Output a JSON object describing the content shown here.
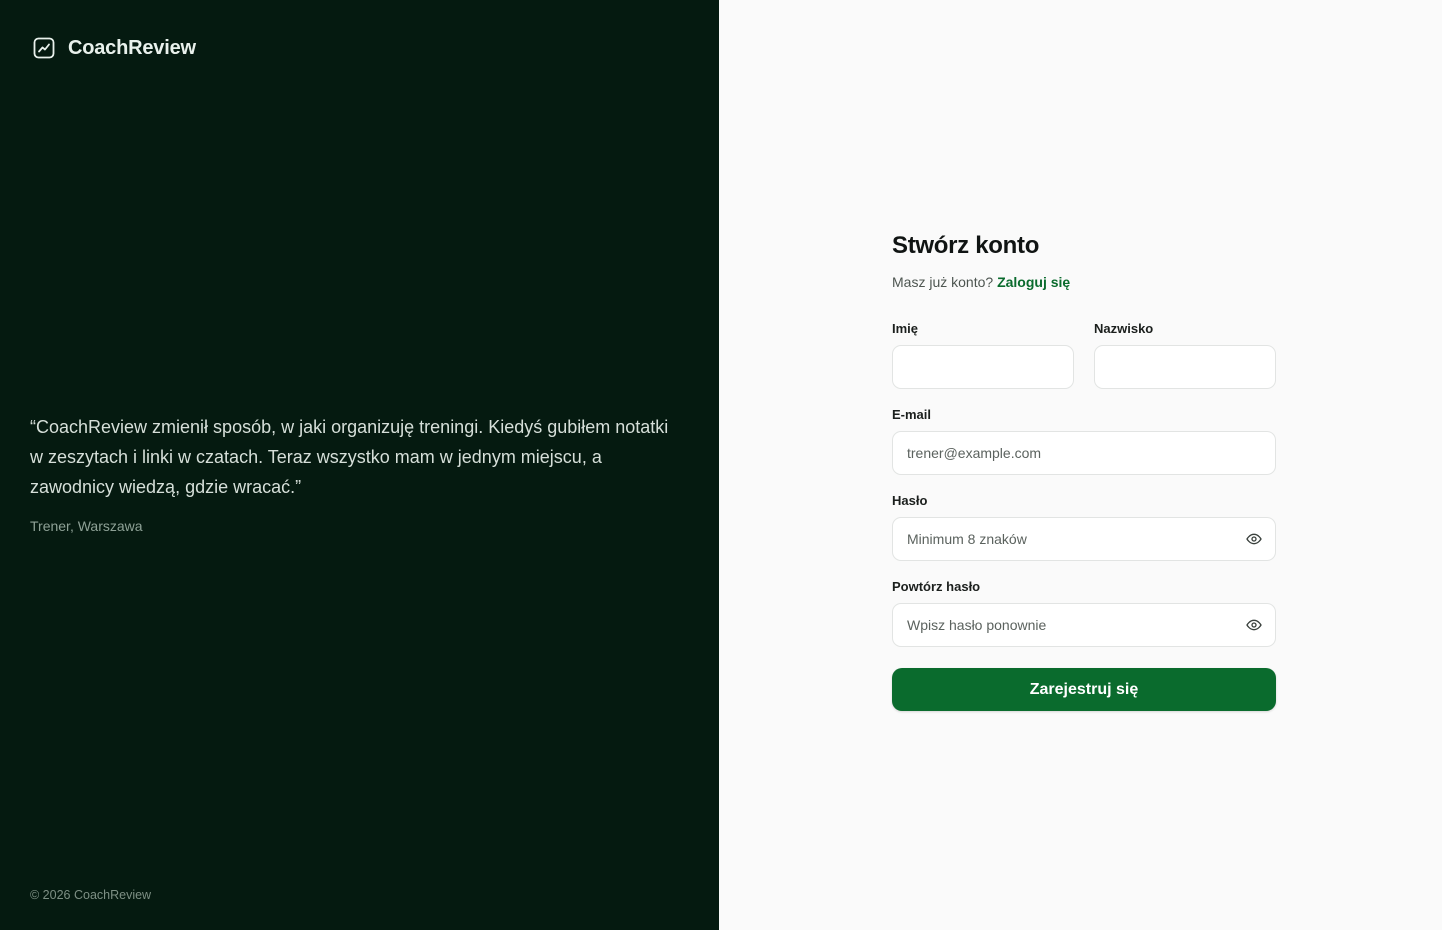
{
  "brand": {
    "name": "CoachReview",
    "icon": "trending-chart-icon"
  },
  "testimonial": {
    "quote": "“CoachReview zmienił sposób, w jaki organizuję treningi. Kiedyś gubiłem notatki w zeszytach i linki w czatach. Teraz wszystko mam w jednym miejscu, a zawodnicy wiedzą, gdzie wracać.”",
    "author": "Trener, Warszawa"
  },
  "footer": {
    "copyright": "© 2026 CoachReview"
  },
  "form": {
    "title": "Stwórz konto",
    "have_account": "Masz już konto?",
    "login_link": "Zaloguj się",
    "first_name": {
      "label": "Imię",
      "value": "",
      "placeholder": ""
    },
    "last_name": {
      "label": "Nazwisko",
      "value": "",
      "placeholder": ""
    },
    "email": {
      "label": "E-mail",
      "value": "",
      "placeholder": "trener@example.com"
    },
    "password": {
      "label": "Hasło",
      "value": "",
      "placeholder": "Minimum 8 znaków",
      "icon": "eye-icon"
    },
    "confirm_password": {
      "label": "Powtórz hasło",
      "value": "",
      "placeholder": "Wpisz hasło ponownie",
      "icon": "eye-icon"
    },
    "submit_label": "Zarejestruj się"
  },
  "colors": {
    "left_bg": "#051a10",
    "right_bg": "#fafafa",
    "accent": "#0a6b2d"
  }
}
